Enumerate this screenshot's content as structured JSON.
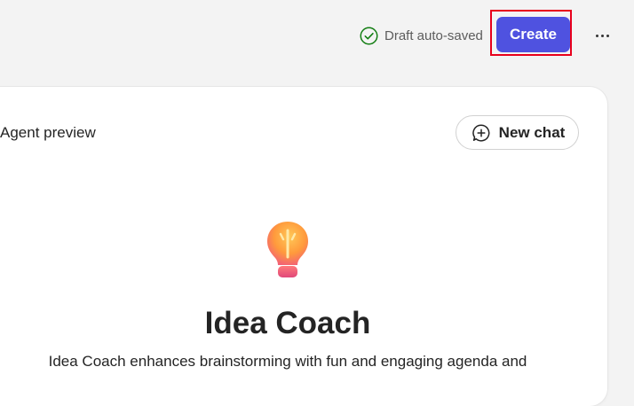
{
  "header": {
    "draft_status": "Draft auto-saved",
    "create_label": "Create"
  },
  "preview": {
    "title": "Agent preview",
    "new_chat_label": "New chat",
    "agent_name": "Idea Coach",
    "agent_description": "Idea Coach enhances brainstorming with fun and engaging agenda and"
  },
  "colors": {
    "accent": "#4f52e0",
    "highlight": "#e8001c",
    "success": "#107c10"
  },
  "icons": {
    "status": "checkmark-circle-icon",
    "more": "more-horizontal-icon",
    "new_chat": "chat-add-icon",
    "agent": "lightbulb-icon"
  }
}
